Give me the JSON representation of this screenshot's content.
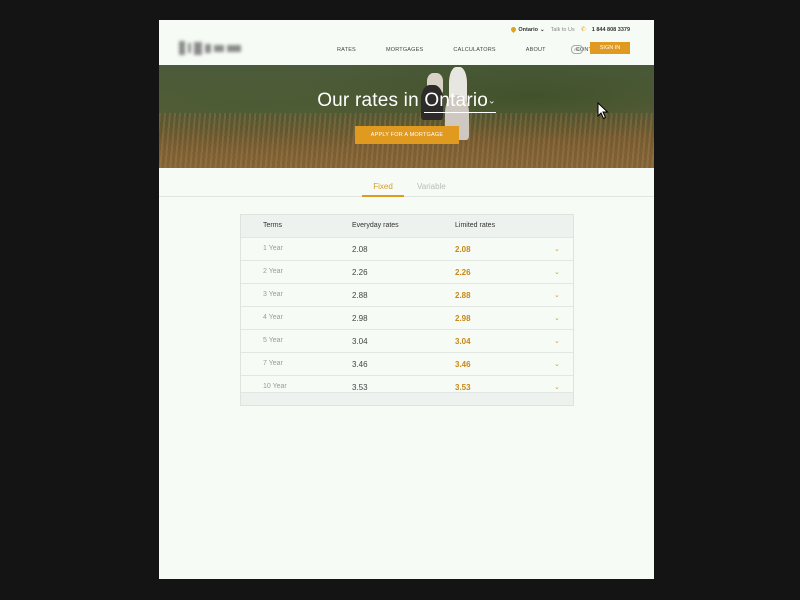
{
  "header": {
    "region": "Ontario",
    "talk_label": "Talk to Us",
    "phone": "1 844 808 3379",
    "nav": [
      "RATES",
      "MORTGAGES",
      "CALCULATORS",
      "ABOUT",
      "CONTACT"
    ],
    "lang": "FR",
    "signin_label": "SIGN IN"
  },
  "hero": {
    "title_prefix": "Our rates in ",
    "location": "Ontario",
    "apply_label": "APPLY FOR A MORTGAGE"
  },
  "tabs": [
    "Fixed",
    "Variable"
  ],
  "table": {
    "headers": [
      "Terms",
      "Everyday rates",
      "Limited rates"
    ],
    "rows": [
      {
        "term": "1 Year",
        "everyday": "2.08",
        "limited": "2.08"
      },
      {
        "term": "2 Year",
        "everyday": "2.26",
        "limited": "2.26"
      },
      {
        "term": "3 Year",
        "everyday": "2.88",
        "limited": "2.88"
      },
      {
        "term": "4 Year",
        "everyday": "2.98",
        "limited": "2.98"
      },
      {
        "term": "5 Year",
        "everyday": "3.04",
        "limited": "3.04"
      },
      {
        "term": "7 Year",
        "everyday": "3.46",
        "limited": "3.46"
      },
      {
        "term": "10 Year",
        "everyday": "3.53",
        "limited": "3.53"
      }
    ]
  },
  "colors": {
    "accent": "#e09a20",
    "page_bg": "#f6fcf5",
    "outer_bg": "#141414"
  },
  "icons": [
    "location-pin-icon",
    "chevron-down-icon",
    "phone-icon",
    "cursor-icon"
  ]
}
